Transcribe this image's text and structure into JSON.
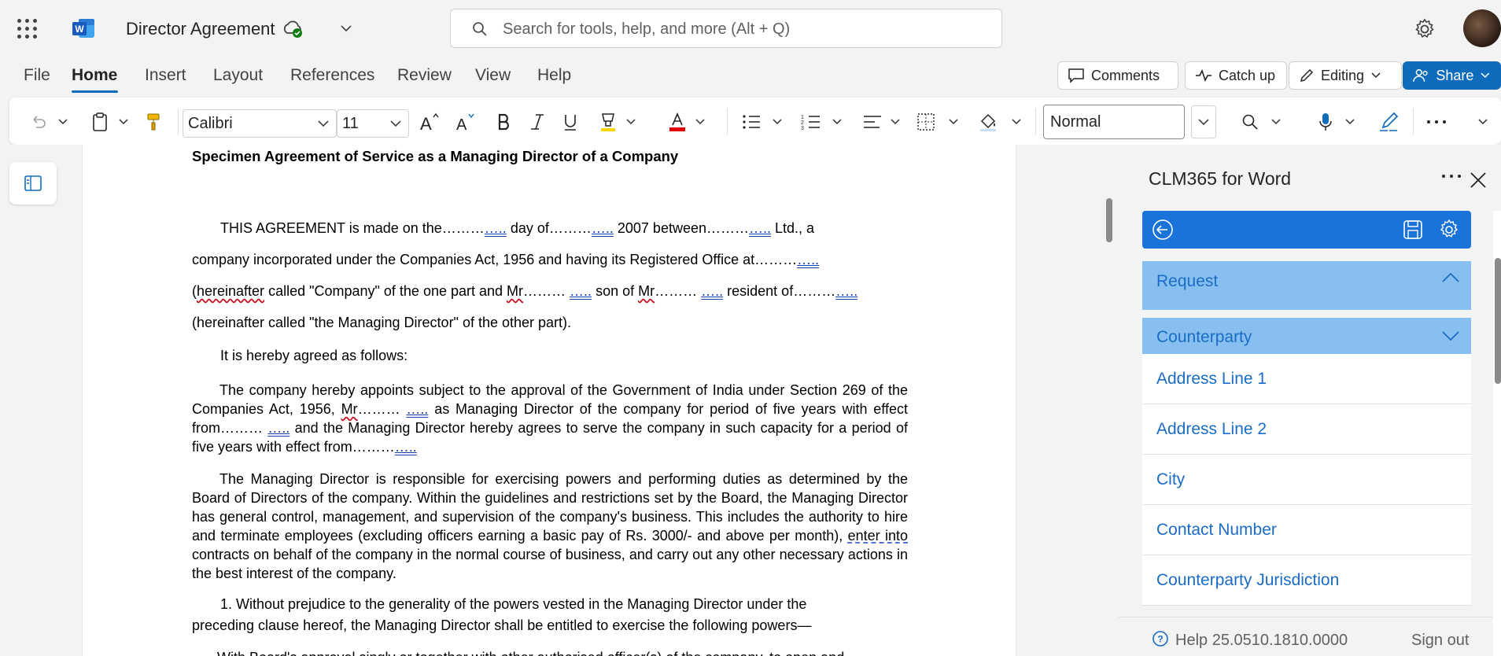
{
  "app": {
    "doc_title": "Director Agreement",
    "search_placeholder": "Search for tools, help, and more (Alt + Q)"
  },
  "menu": {
    "items": [
      "File",
      "Home",
      "Insert",
      "Layout",
      "References",
      "Review",
      "View",
      "Help"
    ],
    "active": "Home",
    "comments": "Comments",
    "catchup": "Catch up",
    "editing": "Editing",
    "share": "Share"
  },
  "ribbon": {
    "font_name": "Calibri",
    "font_size": "11",
    "style": "Normal"
  },
  "document": {
    "heading": "Specimen Agreement of Service as a Managing Director of a Company",
    "p1_a": "THIS AGREEMENT is made on the………",
    "p1_b": "day of………",
    "p1_c": "2007 between………",
    "p1_d": "Ltd., a",
    "p2_a": "company incorporated under the Companies Act, 1956 and having its Registered Office at………",
    "p3_open": "(",
    "p3_hereinafter": "hereinafter",
    "p3_a": " called \"Company\" of the one part and ",
    "p3_mr1": "Mr",
    "p3_b": "……… ",
    "p3_c": " son of ",
    "p3_mr2": "Mr",
    "p3_d": "……… ",
    "p3_e": " resident of………",
    "p4": "(hereinafter called \"the Managing Director\" of the other part).",
    "p5": "It is hereby agreed as follows:",
    "p6_a": "The company hereby appoints subject to the approval of the Government of India under Section 269 of the Companies Act, 1956, ",
    "p6_mr": "Mr",
    "p6_b": "……… ",
    "p6_c": " as Managing Director of the company for period of five years with effect from……… ",
    "p6_d": " and the Managing Director hereby agrees to serve the company in such capacity for a period of five years with effect from………",
    "p7_a": "The Managing Director is responsible for exercising powers and performing duties as determined by the Board of Directors of the company. Within the guidelines and restrictions set by the Board, the Managing Director has general control, management, and supervision of the company's business. This includes the authority to hire and terminate employees (excluding officers earning a basic pay of Rs. 3000/- and above per month), ",
    "p7_enter": "enter into",
    "p7_b": " contracts on behalf of the company in the normal course of business, and carry out any other necessary actions in the best interest of the company.",
    "p8": "1.  Without prejudice to the generality of the powers vested in the Managing Director under the",
    "p9": "preceding clause hereof, the Managing Director shall be entitled to exercise the following powers—",
    "p10": "With Board's approval singly or together with other authorised officer(s) of the company, to open and",
    "blank": "….."
  },
  "sidepane": {
    "title": "CLM365 for Word",
    "sections": [
      {
        "label": "Request",
        "state": "expanded"
      },
      {
        "label": "Counterparty",
        "state": "collapsed"
      }
    ],
    "fields": [
      "Address Line 1",
      "Address Line 2",
      "City",
      "Contact Number",
      "Counterparty Jurisdiction"
    ],
    "help_text": "Help 25.0510.1810.0000",
    "signout": "Sign out"
  },
  "colors": {
    "accent": "#0f6cbd",
    "pane_toolbar": "#1a73d9",
    "accordion": "#87c0f0",
    "link": "#1a6cc4"
  }
}
